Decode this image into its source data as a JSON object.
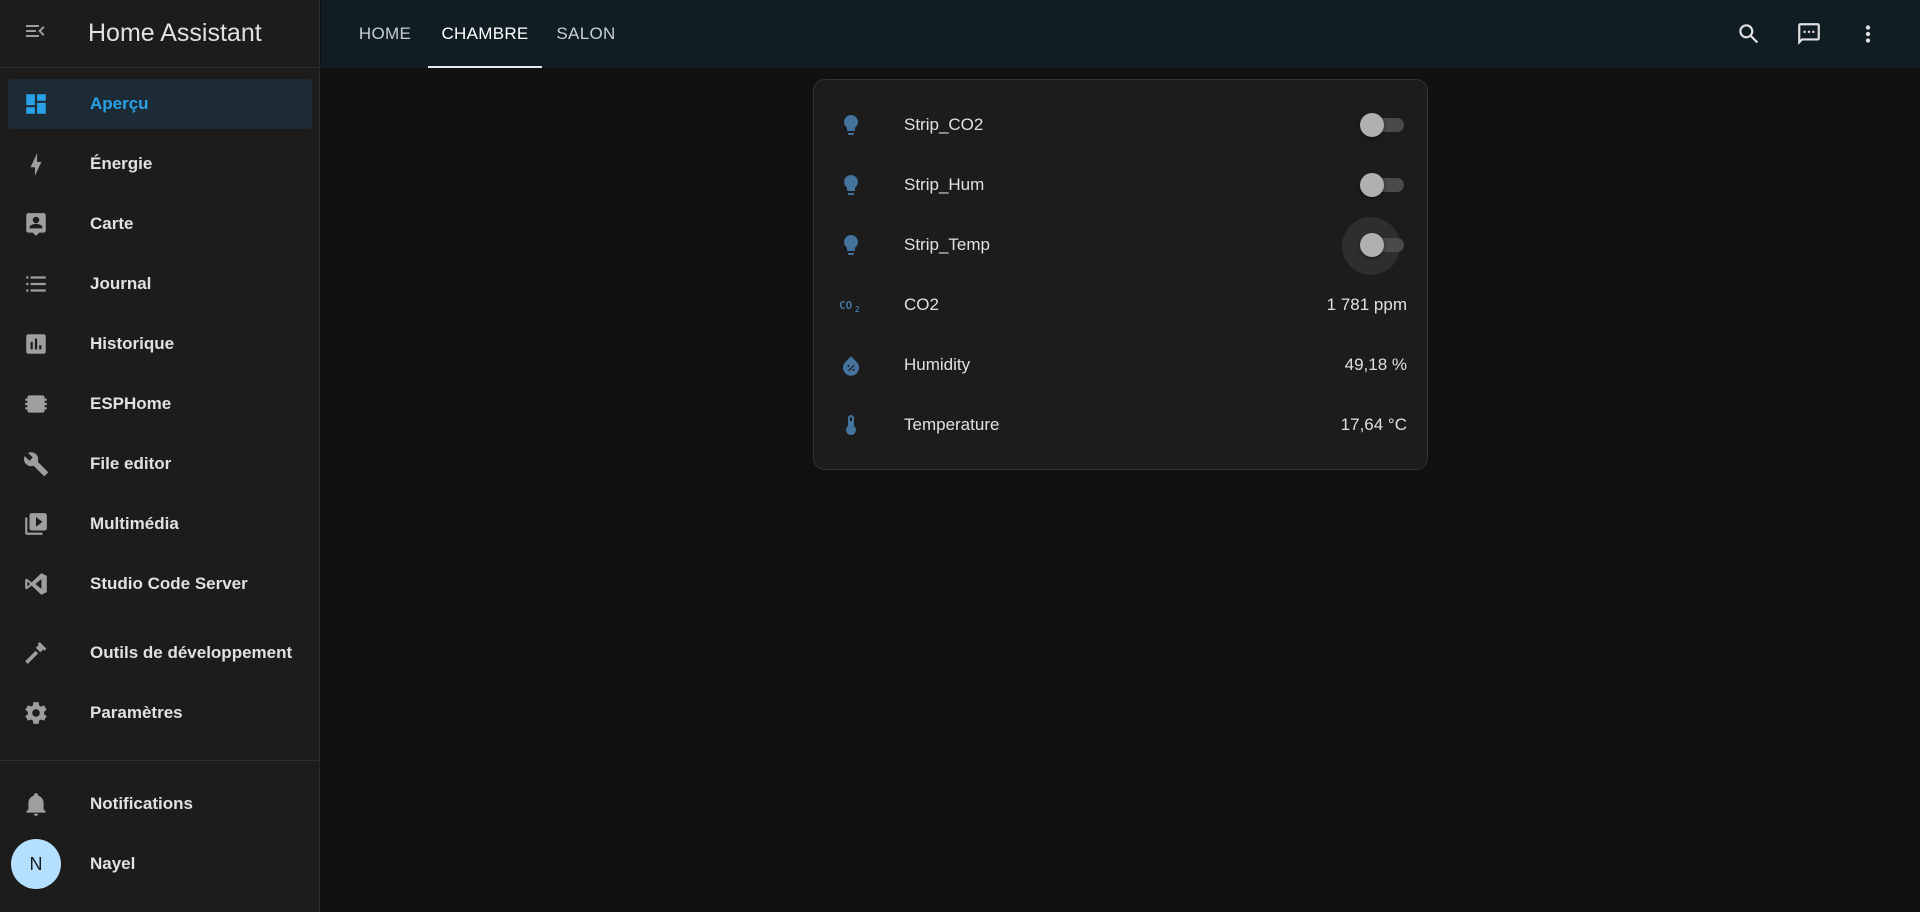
{
  "app": {
    "title": "Home Assistant"
  },
  "sidebar": {
    "items": [
      {
        "label": "Aperçu",
        "icon": "dashboard-icon",
        "active": true
      },
      {
        "label": "Énergie",
        "icon": "lightning-bolt-icon"
      },
      {
        "label": "Carte",
        "icon": "map-account-icon"
      },
      {
        "label": "Journal",
        "icon": "list-icon"
      },
      {
        "label": "Historique",
        "icon": "chart-box-icon"
      },
      {
        "label": "ESPHome",
        "icon": "chip-icon"
      },
      {
        "label": "File editor",
        "icon": "wrench-icon"
      },
      {
        "label": "Multimédia",
        "icon": "play-box-multiple-icon"
      },
      {
        "label": "Studio Code Server",
        "icon": "vscode-icon"
      },
      {
        "label": "Outils de développement",
        "icon": "hammer-icon"
      },
      {
        "label": "Paramètres",
        "icon": "gear-icon"
      }
    ],
    "notifications_label": "Notifications",
    "user": {
      "name": "Nayel",
      "initial": "N"
    }
  },
  "topbar": {
    "tabs": [
      {
        "label": "HOME"
      },
      {
        "label": "CHAMBRE",
        "active": true
      },
      {
        "label": "SALON"
      }
    ],
    "icons": [
      "search-icon",
      "assist-chat-icon",
      "more-vertical-icon"
    ]
  },
  "card": {
    "entities": [
      {
        "name": "Strip_CO2",
        "icon": "lightbulb-icon",
        "type": "switch",
        "state": "off"
      },
      {
        "name": "Strip_Hum",
        "icon": "lightbulb-icon",
        "type": "switch",
        "state": "off"
      },
      {
        "name": "Strip_Temp",
        "icon": "lightbulb-icon",
        "type": "switch",
        "state": "off"
      },
      {
        "name": "CO2",
        "icon": "molecule-co2-icon",
        "type": "sensor",
        "value": "1 781 ppm"
      },
      {
        "name": "Humidity",
        "icon": "water-percent-icon",
        "type": "sensor",
        "value": "49,18 %"
      },
      {
        "name": "Temperature",
        "icon": "thermometer-icon",
        "type": "sensor",
        "value": "17,64 °C"
      }
    ]
  },
  "colors": {
    "accent": "#2aa1e6",
    "entity_icon": "#44739e",
    "sidebar_bg": "#1c1c1c",
    "topbar_bg": "#101e24",
    "page_bg": "#111111"
  }
}
